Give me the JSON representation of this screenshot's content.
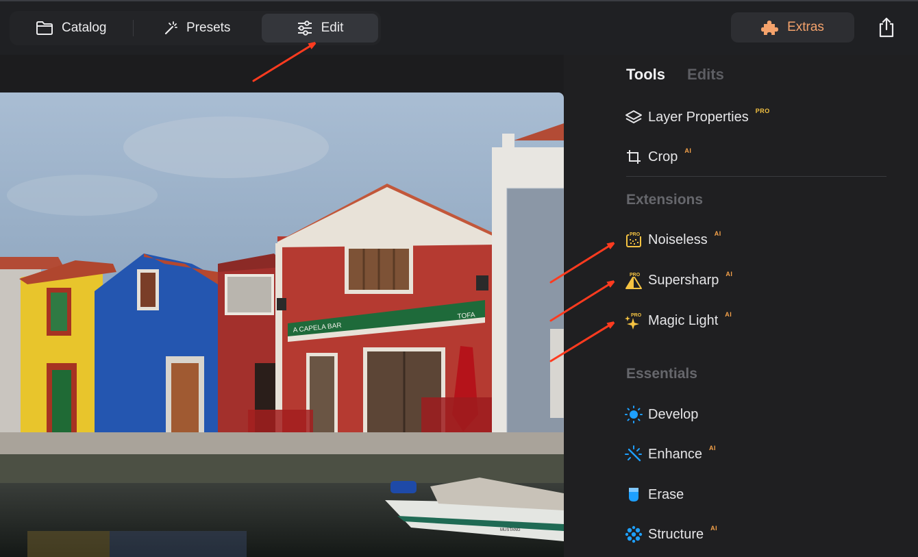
{
  "toolbar": {
    "catalog_label": "Catalog",
    "presets_label": "Presets",
    "edit_label": "Edit",
    "extras_label": "Extras"
  },
  "panel": {
    "tabs": [
      "Tools",
      "Edits"
    ],
    "tools": [
      {
        "label": "Layer Properties",
        "badge": "PRO",
        "icon": "layers-icon"
      },
      {
        "label": "Crop",
        "badge": "AI",
        "icon": "crop-icon"
      }
    ],
    "extensions_title": "Extensions",
    "extensions": [
      {
        "label": "Noiseless",
        "badge": "AI",
        "icon_badge": "PRO",
        "icon": "noiseless-icon"
      },
      {
        "label": "Supersharp",
        "badge": "AI",
        "icon_badge": "PRO",
        "icon": "supersharp-icon"
      },
      {
        "label": "Magic Light",
        "badge": "AI",
        "icon_badge": "PRO",
        "icon": "magic-light-icon"
      }
    ],
    "essentials_title": "Essentials",
    "essentials": [
      {
        "label": "Develop",
        "badge": "",
        "icon": "develop-icon"
      },
      {
        "label": "Enhance",
        "badge": "AI",
        "icon": "enhance-icon"
      },
      {
        "label": "Erase",
        "badge": "",
        "icon": "erase-icon"
      },
      {
        "label": "Structure",
        "badge": "AI",
        "icon": "structure-icon"
      }
    ]
  },
  "photo": {
    "sign_text": "A CAPELA BAR",
    "sign_text_right": "TOFA",
    "boat_name": "MUSTANG"
  },
  "colors": {
    "accent_extras": "#f5a36c",
    "pro_badge": "#f5c342",
    "ai_badge": "#f5a24a",
    "annotation_arrow": "#ff3b1f",
    "icon_blue": "#1ea0ff"
  }
}
